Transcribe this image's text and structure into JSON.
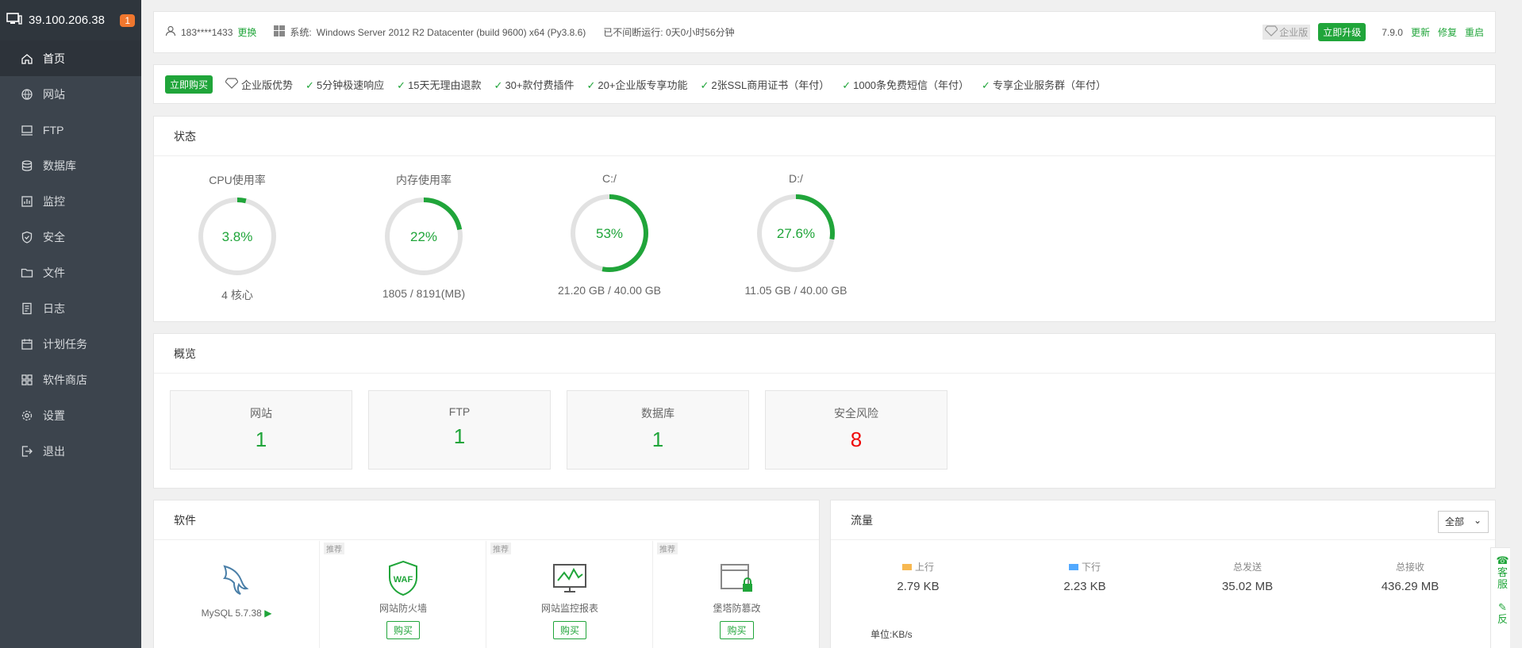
{
  "sidebar": {
    "ip": "39.100.206.38",
    "badge": "1",
    "items": [
      {
        "label": "首页",
        "icon": "home-icon"
      },
      {
        "label": "网站",
        "icon": "globe-icon"
      },
      {
        "label": "FTP",
        "icon": "ftp-icon"
      },
      {
        "label": "数据库",
        "icon": "database-icon"
      },
      {
        "label": "监控",
        "icon": "monitor-icon"
      },
      {
        "label": "安全",
        "icon": "shield-icon"
      },
      {
        "label": "文件",
        "icon": "folder-icon"
      },
      {
        "label": "日志",
        "icon": "log-icon"
      },
      {
        "label": "计划任务",
        "icon": "calendar-icon"
      },
      {
        "label": "软件商店",
        "icon": "apps-icon"
      },
      {
        "label": "设置",
        "icon": "gear-icon"
      },
      {
        "label": "退出",
        "icon": "logout-icon"
      }
    ]
  },
  "topbar": {
    "user": "183****1433",
    "change": "更换",
    "system_label": "系统:",
    "system_value": "Windows Server 2012 R2 Datacenter (build 9600) x64 (Py3.8.6)",
    "uptime": "已不间断运行: 0天0小时56分钟",
    "enterprise": "企业版",
    "upgrade": "立即升级",
    "version": "7.9.0",
    "update": "更新",
    "repair": "修复",
    "restart": "重启"
  },
  "promo": {
    "buy": "立即购买",
    "advantage": "企业版优势",
    "features": [
      "5分钟极速响应",
      "15天无理由退款",
      "30+款付费插件",
      "20+企业版专享功能",
      "2张SSL商用证书（年付）",
      "1000条免费短信（年付）",
      "专享企业服务群（年付）"
    ]
  },
  "status": {
    "title": "状态",
    "gauges": [
      {
        "label": "CPU使用率",
        "value": "3.8%",
        "percent": 3.8,
        "sub": "4 核心"
      },
      {
        "label": "内存使用率",
        "value": "22%",
        "percent": 22,
        "sub": "1805 / 8191(MB)"
      },
      {
        "label": "C:/",
        "value": "53%",
        "percent": 53,
        "sub": "21.20 GB / 40.00 GB"
      },
      {
        "label": "D:/",
        "value": "27.6%",
        "percent": 27.6,
        "sub": "11.05 GB / 40.00 GB"
      }
    ],
    "color": "#20a53a"
  },
  "overview": {
    "title": "概览",
    "cards": [
      {
        "name": "网站",
        "num": "1"
      },
      {
        "name": "FTP",
        "num": "1"
      },
      {
        "name": "数据库",
        "num": "1"
      },
      {
        "name": "安全风险",
        "num": "8"
      }
    ]
  },
  "software": {
    "title": "软件",
    "items": [
      {
        "name": "MySQL 5.7.38",
        "rec": "",
        "buy": ""
      },
      {
        "name": "网站防火墙",
        "rec": "推荐",
        "buy": "购买"
      },
      {
        "name": "网站监控报表",
        "rec": "推荐",
        "buy": "购买"
      },
      {
        "name": "堡塔防篡改",
        "rec": "推荐",
        "buy": "购买"
      }
    ],
    "waf_text": "WAF"
  },
  "traffic": {
    "title": "流量",
    "select": "全部",
    "stats": [
      {
        "k": "上行",
        "v": "2.79 KB",
        "color": "#f7b851"
      },
      {
        "k": "下行",
        "v": "2.23 KB",
        "color": "#52a9ff"
      },
      {
        "k": "总发送",
        "v": "35.02 MB",
        "color": ""
      },
      {
        "k": "总接收",
        "v": "436.29 MB",
        "color": ""
      }
    ],
    "unit": "单位:KB/s"
  },
  "float": {
    "service": "客服",
    "feedback": "反"
  }
}
